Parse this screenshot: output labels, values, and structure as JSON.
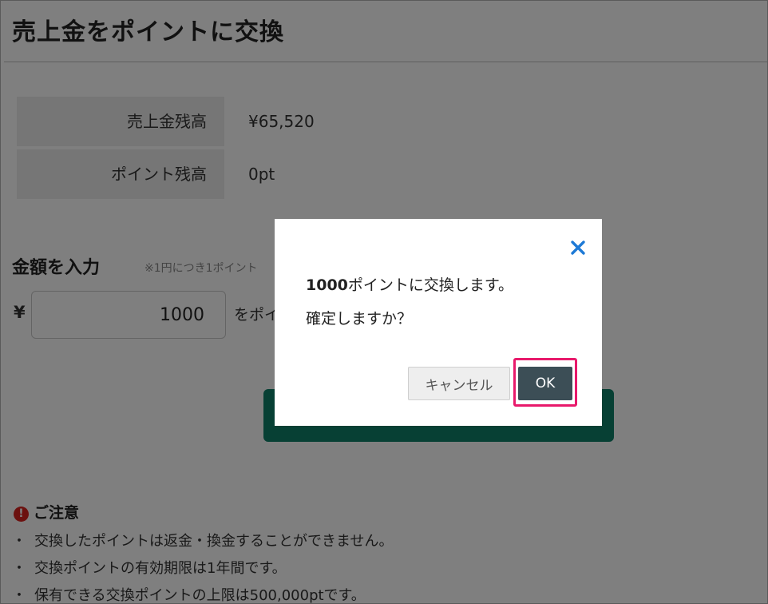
{
  "page": {
    "title": "売上金をポイントに交換"
  },
  "balances": [
    {
      "label": "売上金残高",
      "value": "¥65,520"
    },
    {
      "label": "ポイント残高",
      "value": "0pt"
    }
  ],
  "amount": {
    "heading": "金額を入力",
    "note": "※1円につき1ポイント",
    "currency_symbol": "¥",
    "value": "1000",
    "suffix": "をポイ"
  },
  "notes": {
    "heading": "ご注意",
    "icon": "exclamation-circle-icon",
    "bullet": "・",
    "items": [
      "交換したポイントは返金・換金することができません。",
      "交換ポイントの有効期限は1年間です。",
      "保有できる交換ポイントの上限は500,000ptです。"
    ]
  },
  "modal": {
    "amount": "1000",
    "message_rest": "ポイントに交換します。",
    "confirm": "確定しますか？",
    "cancel_label": "キャンセル",
    "ok_label": "OK",
    "close_icon": "close-icon"
  },
  "colors": {
    "submit_button": "#0e8069",
    "ok_button": "#3c4e56",
    "highlight": "#e8196b",
    "close_icon": "#1e7ad6",
    "warning": "#d9221f"
  }
}
